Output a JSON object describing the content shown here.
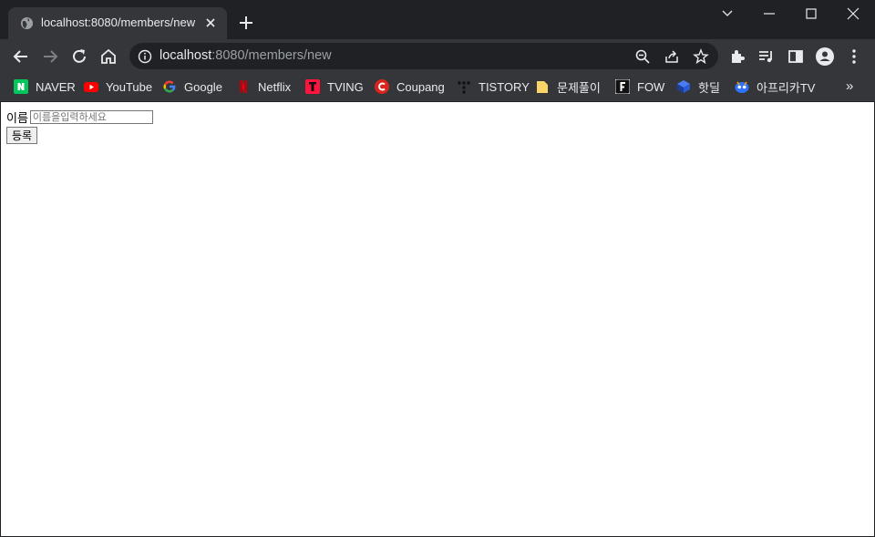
{
  "browser": {
    "tab": {
      "title": "localhost:8080/members/new"
    },
    "omnibox": {
      "host": "localhost",
      "path": ":8080/members/new"
    },
    "bookmarks": [
      {
        "label": "NAVER",
        "icon": "naver-icon",
        "color": "#03c75a"
      },
      {
        "label": "YouTube",
        "icon": "youtube-icon",
        "color": "#ff0000"
      },
      {
        "label": "Google",
        "icon": "google-icon",
        "color": "#4285f4"
      },
      {
        "label": "Netflix",
        "icon": "netflix-icon",
        "color": "#e50914"
      },
      {
        "label": "TVING",
        "icon": "tving-icon",
        "color": "#ff153c"
      },
      {
        "label": "Coupang",
        "icon": "coupang-icon",
        "color": "#d9251d"
      },
      {
        "label": "TISTORY",
        "icon": "tistory-icon",
        "color": "#000000"
      },
      {
        "label": "문제풀이",
        "icon": "folder-icon",
        "color": "#f9d568"
      },
      {
        "label": "FOW",
        "icon": "fow-icon",
        "color": "#ffffff"
      },
      {
        "label": "핫딜",
        "icon": "hotdeal-icon",
        "color": "#2a5bd7"
      },
      {
        "label": "아프리카TV",
        "icon": "afreecatv-icon",
        "color": "#2d73ff"
      }
    ]
  },
  "form": {
    "name_label": "이름",
    "name_placeholder": "이름을입력하세요",
    "submit_label": "등록"
  }
}
